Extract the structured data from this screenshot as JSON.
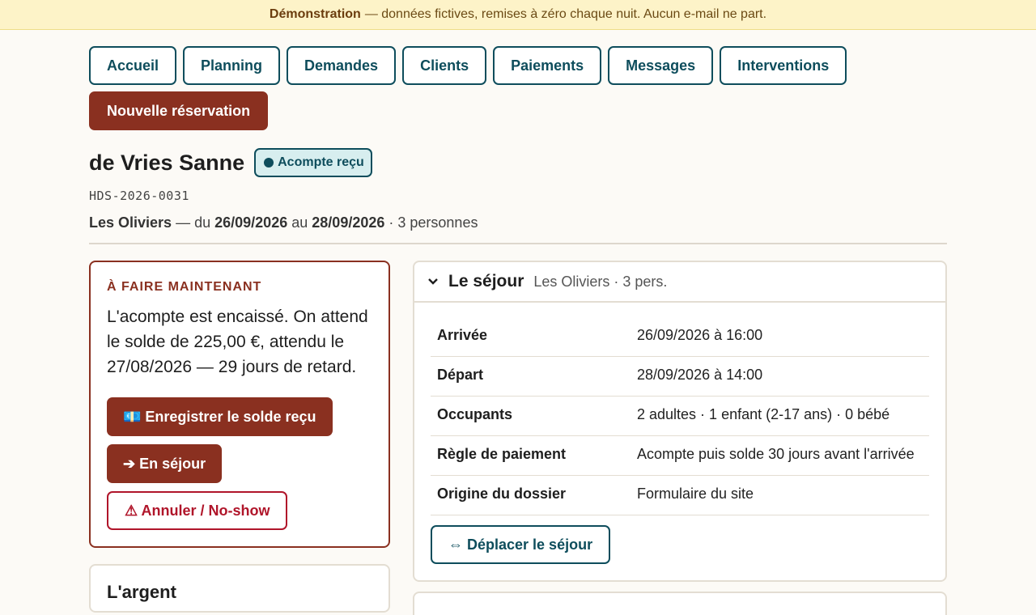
{
  "banner": {
    "bold": "Démonstration",
    "text": "— données fictives, remises à zéro chaque nuit. Aucun e-mail ne part."
  },
  "nav": {
    "items": [
      "Accueil",
      "Planning",
      "Demandes",
      "Clients",
      "Paiements",
      "Messages",
      "Interventions"
    ],
    "primary": "Nouvelle réservation"
  },
  "booking": {
    "name": "de Vries Sanne",
    "status": "Acompte reçu",
    "reference": "HDS-2026-0031",
    "summary": {
      "property": "Les Oliviers",
      "from_prefix": "— du",
      "start": "26/09/2026",
      "to_word": "au",
      "end": "28/09/2026",
      "guests": "· 3 personnes"
    }
  },
  "todo": {
    "heading": "À FAIRE MAINTENANT",
    "text": "L'acompte est encaissé. On attend le solde de 225,00 €, attendu le 27/08/2026 — 29 jours de retard.",
    "actions": {
      "record": "💶 Enregistrer le solde reçu",
      "stay": "➔ En séjour",
      "cancel": "⚠ Annuler / No-show"
    }
  },
  "money": {
    "title": "L'argent"
  },
  "stay": {
    "title": "Le séjour",
    "subtitle": "Les Oliviers · 3 pers.",
    "rows": [
      {
        "label": "Arrivée",
        "value": "26/09/2026 à 16:00"
      },
      {
        "label": "Départ",
        "value": "28/09/2026 à 14:00"
      },
      {
        "label": "Occupants",
        "value": "2 adultes · 1 enfant (2-17 ans) · 0 bébé"
      },
      {
        "label": "Règle de paiement",
        "value": "Acompte puis solde 30 jours avant l'arrivée"
      },
      {
        "label": "Origine du dossier",
        "value": "Formulaire du site"
      }
    ],
    "move_button": "⇔ Déplacer le séjour"
  }
}
